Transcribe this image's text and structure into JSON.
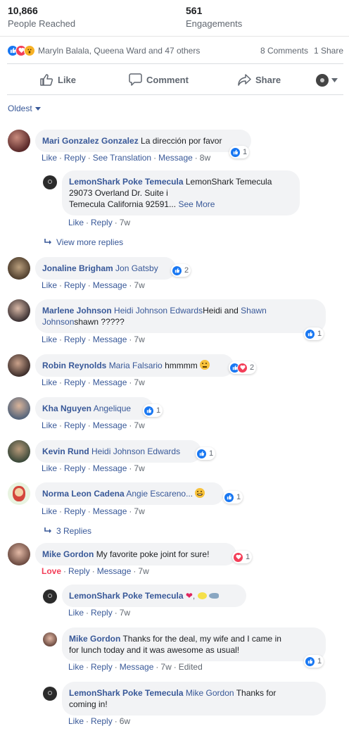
{
  "stats": {
    "reached_value": "10,866",
    "reached_label": "People Reached",
    "engagements_value": "561",
    "engagements_label": "Engagements"
  },
  "reactions_bar": {
    "names": "Maryln Balala, Queena Ward and 47 others",
    "comments": "8 Comments",
    "shares": "1 Share"
  },
  "actions": {
    "like": "Like",
    "comment": "Comment",
    "share": "Share"
  },
  "sort": {
    "label": "Oldest"
  },
  "comments": [
    {
      "name": "Mari Gonzalez Gonzalez",
      "text": "La dirección por favor",
      "meta": {
        "like": "Like",
        "reply": "Reply",
        "extra": "See Translation",
        "message": "Message",
        "time": "8w"
      },
      "reactions": {
        "count": "1"
      },
      "replies": [
        {
          "name": "LemonShark Poke Temecula",
          "text": "LemonShark Temecula",
          "line2": "29073 Overland Dr. Suite i",
          "line3": "Temecula California 92591...",
          "see_more": "See More",
          "meta": {
            "like": "Like",
            "reply": "Reply",
            "time": "7w"
          }
        }
      ],
      "view_more": "View more replies"
    },
    {
      "name": "Jonaline Brigham",
      "tag": "Jon Gatsby",
      "meta": {
        "like": "Like",
        "reply": "Reply",
        "message": "Message",
        "time": "7w"
      },
      "reactions": {
        "count": "2"
      }
    },
    {
      "name": "Marlene Johnson",
      "tag": "Heidi Johnson Edwards",
      "text1": "Heidi and",
      "tag2": "Shawn",
      "tag2b": "Johnson",
      "text2": "shawn ?????",
      "meta": {
        "like": "Like",
        "reply": "Reply",
        "message": "Message",
        "time": "7w"
      },
      "reactions": {
        "count": "1"
      }
    },
    {
      "name": "Robin Reynolds",
      "tag": "Maria Falsario",
      "text": "hmmmm",
      "meta": {
        "like": "Like",
        "reply": "Reply",
        "message": "Message",
        "time": "7w"
      },
      "reactions": {
        "count": "2"
      }
    },
    {
      "name": "Kha Nguyen",
      "tag": "Angelique",
      "meta": {
        "like": "Like",
        "reply": "Reply",
        "message": "Message",
        "time": "7w"
      },
      "reactions": {
        "count": "1"
      }
    },
    {
      "name": "Kevin Rund",
      "tag": "Heidi Johnson Edwards",
      "meta": {
        "like": "Like",
        "reply": "Reply",
        "message": "Message",
        "time": "7w"
      },
      "reactions": {
        "count": "1"
      }
    },
    {
      "name": "Norma Leon Cadena",
      "tag": "Angie Escareno...",
      "meta": {
        "like": "Like",
        "reply": "Reply",
        "message": "Message",
        "time": "7w"
      },
      "reactions": {
        "count": "1"
      },
      "view_more": "3 Replies"
    },
    {
      "name": "Mike Gordon",
      "text": "My favorite poke joint for sure!",
      "meta": {
        "like": "Love",
        "reply": "Reply",
        "message": "Message",
        "time": "7w"
      },
      "reactions": {
        "count": "1"
      },
      "replies": [
        {
          "name": "LemonShark Poke Temecula",
          "meta": {
            "like": "Like",
            "reply": "Reply",
            "time": "7w"
          }
        },
        {
          "name": "Mike Gordon",
          "text": "Thanks for the deal, my wife and I came in",
          "line2": "for lunch today and it was awesome as usual!",
          "meta": {
            "like": "Like",
            "reply": "Reply",
            "message": "Message",
            "time": "7w",
            "edited": "Edited"
          },
          "reactions": {
            "count": "1"
          }
        },
        {
          "name": "LemonShark Poke Temecula",
          "tag": "Mike Gordon",
          "text": "Thanks for",
          "line2": "coming in!",
          "meta": {
            "like": "Like",
            "reply": "Reply",
            "time": "6w"
          }
        }
      ]
    }
  ],
  "colors": {
    "link": "#385898",
    "like": "#1877f2",
    "love": "#f33e58",
    "bubble": "#f2f3f5"
  }
}
